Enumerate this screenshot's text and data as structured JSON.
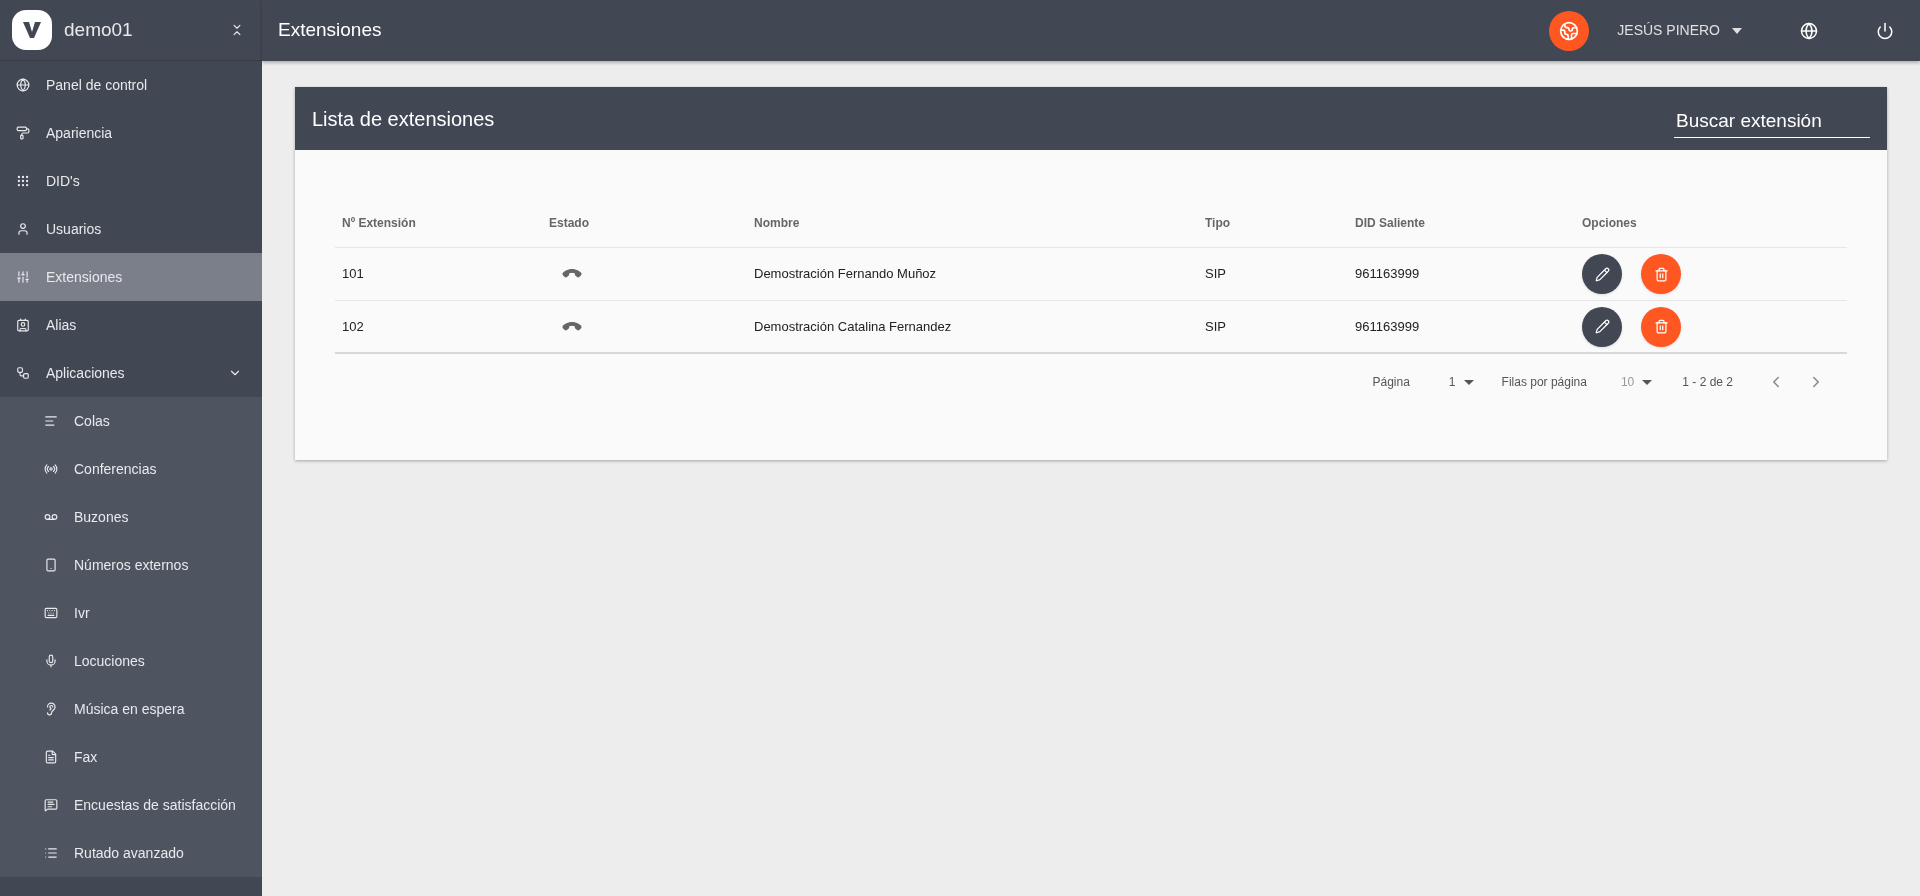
{
  "sidebar": {
    "brand": "demo01",
    "items": [
      {
        "label": "Panel de control",
        "selected": false
      },
      {
        "label": "Apariencia",
        "selected": false
      },
      {
        "label": "DID's",
        "selected": false
      },
      {
        "label": "Usuarios",
        "selected": false
      },
      {
        "label": "Extensiones",
        "selected": true
      },
      {
        "label": "Alias",
        "selected": false
      },
      {
        "label": "Aplicaciones",
        "selected": false,
        "expanded": true,
        "children": [
          {
            "label": "Colas",
            "selected": false
          },
          {
            "label": "Conferencias",
            "selected": false
          },
          {
            "label": "Buzones",
            "selected": false
          },
          {
            "label": "Números externos",
            "selected": false
          },
          {
            "label": "Ivr",
            "selected": false
          },
          {
            "label": "Locuciones",
            "selected": false
          },
          {
            "label": "Música en espera",
            "selected": false
          },
          {
            "label": "Fax",
            "selected": false
          },
          {
            "label": "Encuestas de satisfacción",
            "selected": false
          },
          {
            "label": "Rutado avanzado",
            "selected": false
          }
        ]
      }
    ]
  },
  "header": {
    "title": "Extensiones",
    "user": "JESÚS PINERO"
  },
  "card": {
    "title": "Lista de extensiones",
    "search": {
      "placeholder": "Buscar extensión"
    },
    "table": {
      "columns": [
        "Nº Extensión",
        "Estado",
        "Nombre",
        "Tipo",
        "DID Saliente",
        "Opciones"
      ],
      "rows": [
        {
          "extension": "101",
          "name": "Demostración Fernando Muñoz",
          "type": "SIP",
          "did": "961163999"
        },
        {
          "extension": "102",
          "name": "Demostración Catalina Fernandez",
          "type": "SIP",
          "did": "961163999"
        }
      ]
    },
    "pagination": {
      "page_label": "Página",
      "page": "1",
      "rows_label": "Filas por página",
      "rows_per_page": "10",
      "range": "1 - 2 de 2"
    }
  }
}
